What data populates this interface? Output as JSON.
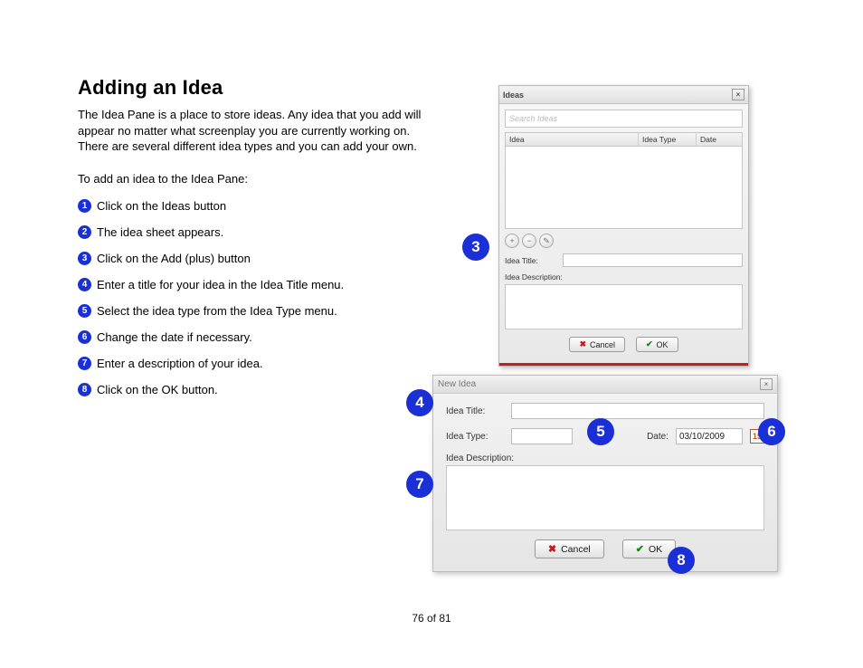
{
  "heading": "Adding an Idea",
  "intro": "The Idea Pane is a place to store ideas. Any idea that you add will appear no matter what screenplay you are currently working on. There are several different idea types and you can add your own.",
  "lead": "To add an idea to the Idea Pane:",
  "steps": [
    "Click on the Ideas button",
    "The idea sheet appears.",
    "Click on the Add (plus) button",
    "Enter a title for your idea in the Idea Title menu.",
    "Select the idea type from the Idea Type menu.",
    "Change the date if necessary.",
    "Enter a description of your idea.",
    "Click on the OK button."
  ],
  "callouts": {
    "c3": "3",
    "c4": "4",
    "c5": "5",
    "c6": "6",
    "c7": "7",
    "c8": "8"
  },
  "ideasWindow": {
    "title": "Ideas",
    "closeGlyph": "×",
    "searchPlaceholder": "Search Ideas",
    "columns": {
      "idea": "Idea",
      "type": "Idea Type",
      "date": "Date"
    },
    "addGlyph": "+",
    "removeGlyph": "−",
    "editGlyph": "✎",
    "labels": {
      "ideaTitle": "Idea Title:",
      "ideaDescription": "Idea Description:"
    },
    "buttons": {
      "cancel": "Cancel",
      "ok": "OK"
    }
  },
  "newIdeaWindow": {
    "title": "New Idea",
    "closeGlyph": "×",
    "labels": {
      "ideaTitle": "Idea Title:",
      "ideaType": "Idea Type:",
      "date": "Date:",
      "ideaDescription": "Idea Description:"
    },
    "dateValue": "03/10/2009",
    "buttons": {
      "cancel": "Cancel",
      "ok": "OK"
    }
  },
  "pageNumber": "76 of 81"
}
